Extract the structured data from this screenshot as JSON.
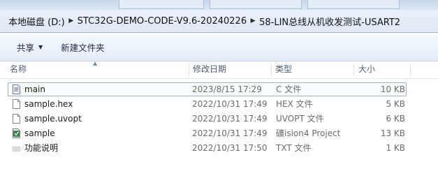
{
  "breadcrumb": [
    "本地磁盘 (D:)",
    "STC32G-DEMO-CODE-V9.6-20240226",
    "58-LIN总线从机收发测试-USART2"
  ],
  "toolbar": {
    "share_label": "共享",
    "new_folder_label": "新建文件夹"
  },
  "columns": {
    "name": "名称",
    "date": "修改日期",
    "type": "类型",
    "size": "大小"
  },
  "files": [
    {
      "name": "main",
      "date": "2023/8/15 17:29",
      "type": "C 文件",
      "size": "10 KB",
      "icon": "c-source-file-icon"
    },
    {
      "name": "sample.hex",
      "date": "2022/10/31 17:49",
      "type": "HEX 文件",
      "size": "5 KB",
      "icon": "document-icon"
    },
    {
      "name": "sample.uvopt",
      "date": "2022/10/31 17:49",
      "type": "UVOPT 文件",
      "size": "6 KB",
      "icon": "document-icon"
    },
    {
      "name": "sample",
      "date": "2022/10/31 17:49",
      "type": "礦ision4 Project",
      "size": "13 KB",
      "icon": "uvision-project-icon"
    },
    {
      "name": "功能说明",
      "date": "2022/10/31 17:50",
      "type": "TXT 文件",
      "size": "1 KB",
      "icon": "text-file-icon"
    }
  ]
}
